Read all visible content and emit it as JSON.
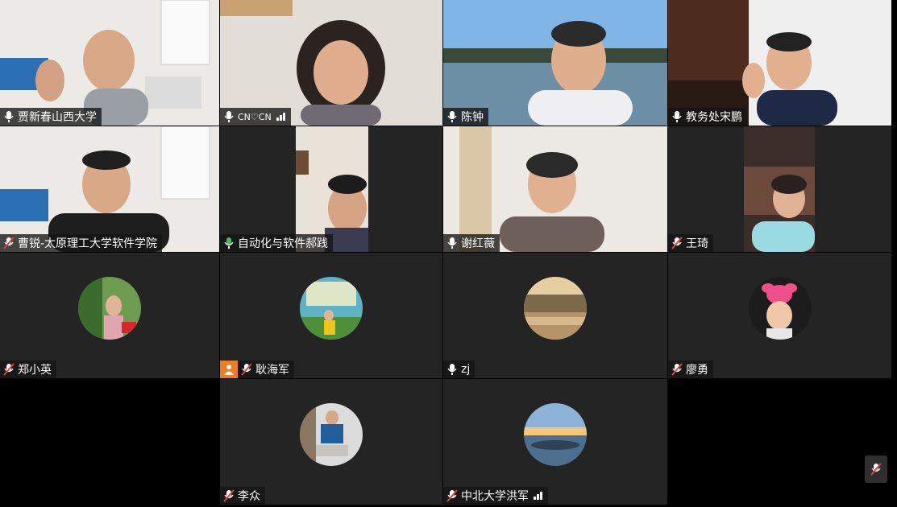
{
  "participants": [
    {
      "name": "贾新春山西大学",
      "mic": "on",
      "kind": "video"
    },
    {
      "name": "CN♡CN",
      "mic": "on",
      "kind": "video",
      "signal": true
    },
    {
      "name": "陈钟",
      "mic": "on",
      "kind": "video"
    },
    {
      "name": "教务处宋鹏",
      "mic": "on",
      "kind": "video"
    },
    {
      "name": "曹锐-太原理工大学软件学院",
      "mic": "muted",
      "kind": "video"
    },
    {
      "name": "自动化与软件郝践",
      "mic": "active",
      "kind": "video"
    },
    {
      "name": "谢红薇",
      "mic": "on",
      "kind": "video"
    },
    {
      "name": "王琦",
      "mic": "muted",
      "kind": "video"
    },
    {
      "name": "郑小英",
      "mic": "muted",
      "kind": "avatar"
    },
    {
      "name": "耿海军",
      "mic": "muted",
      "kind": "avatar",
      "host_badge": true
    },
    {
      "name": "zj",
      "mic": "on",
      "kind": "avatar"
    },
    {
      "name": "廖勇",
      "mic": "muted",
      "kind": "avatar"
    },
    {
      "name": "李众",
      "mic": "muted",
      "kind": "avatar"
    },
    {
      "name": "中北大学洪军",
      "mic": "muted",
      "kind": "avatar",
      "signal": true
    }
  ],
  "colors": {
    "tile_bg": "#242424",
    "plate_bg": "#141414",
    "host_badge": "#ef7d22",
    "signal": "#ffffff"
  },
  "icons": {
    "mic": "microphone-icon",
    "muted": "microphone-muted-icon",
    "signal": "signal-bars-icon",
    "host": "user-icon",
    "corner": "mute-toggle-icon"
  }
}
